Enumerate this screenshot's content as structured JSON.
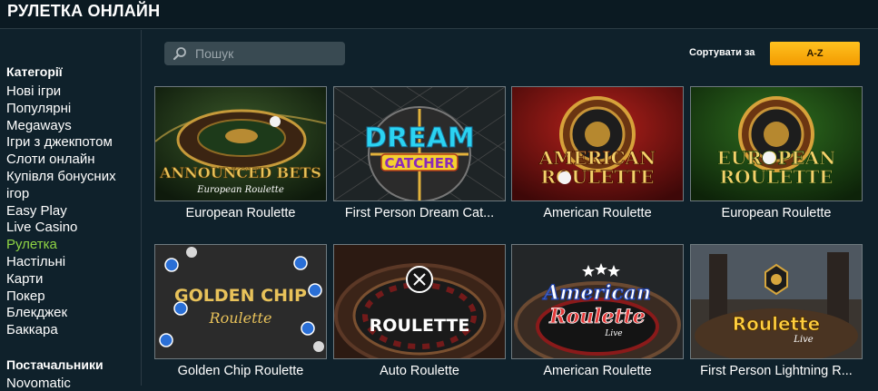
{
  "header": {
    "title": "РУЛЕТКА ОНЛАЙН"
  },
  "sidebar": {
    "categories_title": "Категорії",
    "items": [
      {
        "label": "Нові ігри"
      },
      {
        "label": "Популярні"
      },
      {
        "label": "Megaways"
      },
      {
        "label": "Ігри з джекпотом"
      },
      {
        "label": "Слоти онлайн"
      },
      {
        "label": "Купівля бонусних"
      },
      {
        "label": "ігор"
      },
      {
        "label": "Easy Play"
      },
      {
        "label": "Live Casino"
      },
      {
        "label": "Рулетка",
        "active": true
      },
      {
        "label": "Настільні"
      },
      {
        "label": "Карти"
      },
      {
        "label": "Покер"
      },
      {
        "label": "Блекджек"
      },
      {
        "label": "Баккара"
      }
    ],
    "providers_title": "Постачальники",
    "providers_first": "Novomatic"
  },
  "search": {
    "placeholder": "Пошук",
    "value": "",
    "icon": "search-icon"
  },
  "sort": {
    "label": "Сортувати за",
    "value": "A-Z"
  },
  "accent_color": "#f5a10a",
  "active_color": "#8fd444",
  "games": [
    {
      "name": "European Roulette",
      "art_title": "ANNOUNCED BETS",
      "art_sub": "European Roulette"
    },
    {
      "name": "First Person Dream Cat...",
      "art_title": "DREAM",
      "art_sub": "CATCHER"
    },
    {
      "name": "American Roulette",
      "art_title": "AMERICAN",
      "art_sub": "ROULETTE"
    },
    {
      "name": "European Roulette",
      "art_title": "EUROPEAN",
      "art_sub": "ROULETTE"
    },
    {
      "name": "Golden Chip Roulette",
      "art_title": "GOLDEN CHIP",
      "art_sub": "Roulette"
    },
    {
      "name": "Auto Roulette",
      "art_title": "ROULETTE",
      "art_sub": ""
    },
    {
      "name": "American Roulette",
      "art_title": "American",
      "art_sub": "Roulette"
    },
    {
      "name": "First Person Lightning R...",
      "art_title": "Roulette",
      "art_sub": "Live"
    }
  ]
}
